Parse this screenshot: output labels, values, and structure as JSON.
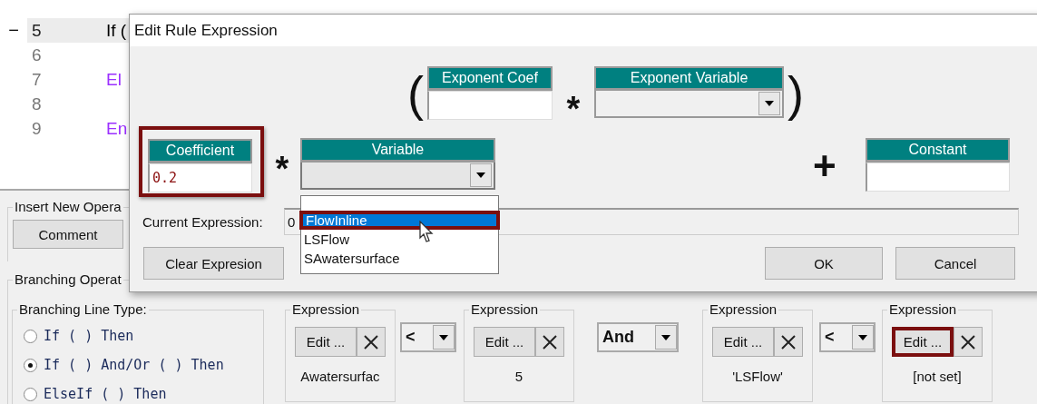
{
  "code_lines": [
    {
      "number": "5",
      "text": "If (",
      "toggle": "−",
      "selected": true,
      "color": "#000000"
    },
    {
      "number": "6",
      "selected": false
    },
    {
      "number": "7",
      "text": "El",
      "selected": false,
      "color": "#9b30ff"
    },
    {
      "number": "8",
      "selected": false
    },
    {
      "number": "9",
      "text": "En",
      "selected": false,
      "color": "#9b30ff"
    }
  ],
  "insert_group": {
    "legend": "Insert New Opera",
    "buttons": [
      "Comment"
    ]
  },
  "branching_group": {
    "legend": "Branching Operat"
  },
  "line_type": {
    "legend": "Branching Line Type:",
    "options": [
      {
        "label": "If ( ) Then",
        "selected": false
      },
      {
        "label": "If ( ) And/Or ( ) Then",
        "selected": true
      },
      {
        "label": "ElseIf ( ) Then",
        "selected": false
      }
    ]
  },
  "conditions": [
    {
      "kind": "expression",
      "legend": "Expression",
      "edit_label": "Edit ...",
      "value": "Awatersurfac",
      "highlighted": false
    },
    {
      "kind": "operator",
      "value": "<"
    },
    {
      "kind": "expression",
      "legend": "Expression",
      "edit_label": "Edit ...",
      "value": "5",
      "highlighted": false
    },
    {
      "kind": "operator",
      "value": "And"
    },
    {
      "kind": "expression",
      "legend": "Expression",
      "edit_label": "Edit ...",
      "value": "'LSFlow'",
      "highlighted": false
    },
    {
      "kind": "operator",
      "value": "<"
    },
    {
      "kind": "expression",
      "legend": "Expression",
      "edit_label": "Edit ...",
      "value": "[not set]",
      "highlighted": true
    }
  ],
  "dialog": {
    "title": "Edit Rule Expression",
    "open_paren": "(",
    "close_paren": ")",
    "exponent_times": "*",
    "times": "*",
    "plus": "+",
    "exponent_coef": {
      "label": "Exponent Coef"
    },
    "exponent_variable": {
      "label": "Exponent Variable"
    },
    "coefficient": {
      "label": "Coefficient",
      "value": "0.2",
      "highlighted": true
    },
    "variable": {
      "label": "Variable",
      "expanded": true,
      "options": [
        {
          "label": "FlowInline",
          "selected": true,
          "highlighted": true
        },
        {
          "label": "LSFlow",
          "selected": false,
          "highlighted": false
        },
        {
          "label": "SAwatersurface",
          "selected": false,
          "highlighted": false
        }
      ]
    },
    "constant": {
      "label": "Constant"
    },
    "current_expression": {
      "label": "Current Expression:",
      "value": "0"
    },
    "buttons": [
      {
        "kind": "clear",
        "label": "Clear Expresion"
      },
      {
        "kind": "ok",
        "label": "OK"
      },
      {
        "kind": "cancel",
        "label": "Cancel"
      }
    ]
  }
}
